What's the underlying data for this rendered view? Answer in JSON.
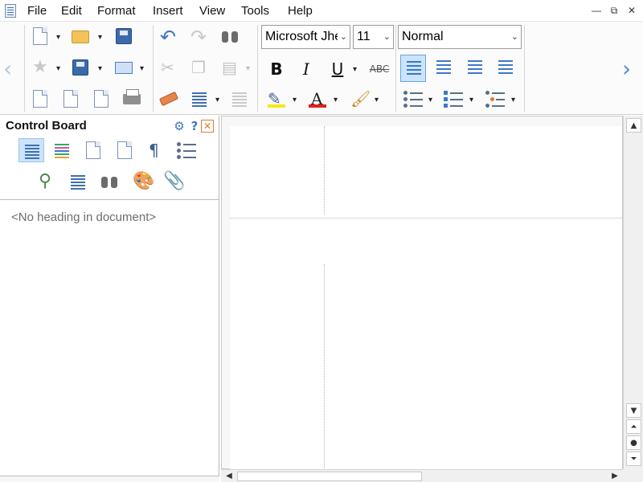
{
  "menu": {
    "items": [
      "File",
      "Edit",
      "Format",
      "Insert",
      "View",
      "Tools",
      "Help"
    ],
    "window_minimize": "—",
    "window_restore": "⧉",
    "window_close": "✕"
  },
  "toolbar": {
    "font_family": "Microsoft JhengHei",
    "font_size": "11",
    "paragraph_style": "Normal",
    "bold_label": "B",
    "italic_label": "I",
    "underline_label": "U",
    "strike_label": "ABC",
    "scroll_left": "‹",
    "scroll_right": "›",
    "dropdown_arrow": "▾"
  },
  "colors": {
    "accent": "#4a90d9",
    "active_bg": "#cbe3fb",
    "highlight": "#f5ea16",
    "font_color": "#e0201b"
  },
  "panel": {
    "title": "Control Board",
    "settings_icon": "⚙",
    "help_icon": "?",
    "close_icon": "✕",
    "empty_message": "<No heading in document>"
  },
  "scroll": {
    "up": "▲",
    "down": "▼",
    "left": "◀",
    "right": "▶",
    "prev_page": "⏶",
    "browse": "●",
    "next_page": "⏷"
  }
}
